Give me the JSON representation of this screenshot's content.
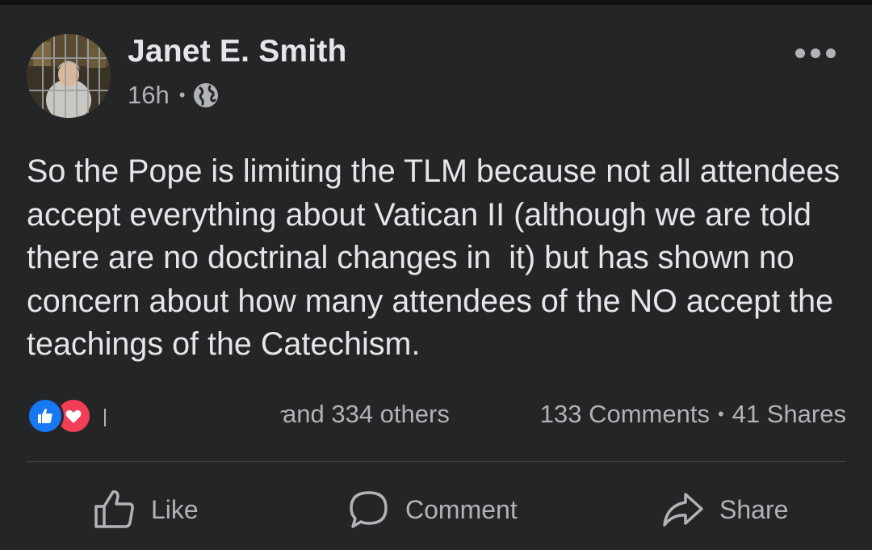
{
  "post": {
    "author": "Janet E. Smith",
    "time": "16h",
    "privacy_icon": "globe-icon",
    "more_icon": "more-horizontal-icon",
    "text": "So the Pope is limiting the TLM because not all attendees accept everything about Vatican II (although we are told there are no doctrinal changes in  it) but has shown no concern about how many attendees of the NO accept the teachings of the Catechism."
  },
  "reactions": {
    "icons": [
      "like-reaction-icon",
      "love-reaction-icon"
    ],
    "summary": "and 334 others",
    "comments": "133 Comments",
    "shares": "41 Shares"
  },
  "actions": {
    "like": "Like",
    "comment": "Comment",
    "share": "Share"
  },
  "colors": {
    "background": "#242526",
    "text_primary": "#e4e6eb",
    "text_secondary": "#b0b3b8",
    "like_blue": "#1877f2",
    "love_red": "#f33e58"
  }
}
